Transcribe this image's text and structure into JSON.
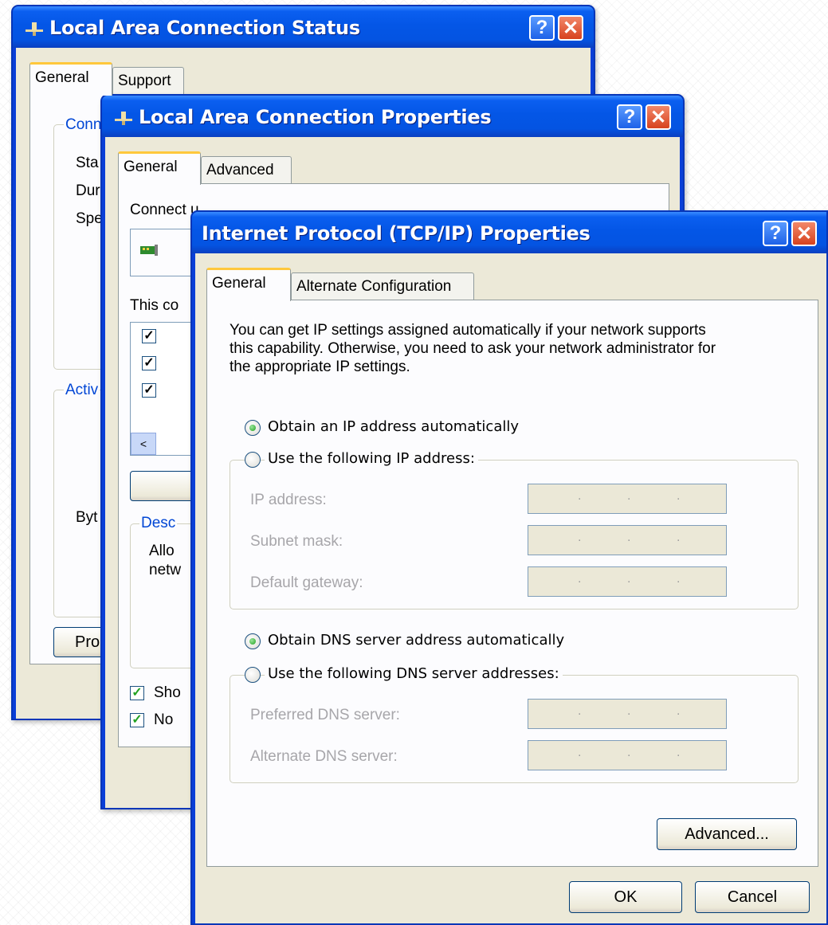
{
  "status_window": {
    "title": "Local Area Connection Status",
    "tabs": [
      "General",
      "Support"
    ],
    "connection_label": "Conn",
    "rows": [
      "Sta",
      "Dur",
      "Spe"
    ],
    "activity_label": "Activ",
    "bytes_label": "Byt",
    "properties_button": "Prop"
  },
  "properties_window": {
    "title": "Local Area Connection Properties",
    "tabs": [
      "General",
      "Advanced"
    ],
    "connect_using_label": "Connect u",
    "this_connection_label": "This co",
    "description_label": "Desc",
    "description_text": [
      "Allo",
      "netw"
    ],
    "show_icon_label": "Sho",
    "notify_label": "No"
  },
  "tcpip_window": {
    "title": "Internet Protocol (TCP/IP) Properties",
    "tabs": [
      "General",
      "Alternate Configuration"
    ],
    "intro_lines": [
      "You can get IP settings assigned automatically if your network supports",
      "this capability. Otherwise, you need to ask your network administrator for",
      "the appropriate IP settings."
    ],
    "obtain_ip_auto": "Obtain an IP address automatically",
    "use_following_ip": "Use the following IP address:",
    "ip_address_label": "IP address:",
    "subnet_mask_label": "Subnet mask:",
    "default_gateway_label": "Default gateway:",
    "obtain_dns_auto": "Obtain DNS server address automatically",
    "use_following_dns": "Use the following DNS server addresses:",
    "preferred_dns_label": "Preferred DNS server:",
    "alternate_dns_label": "Alternate DNS server:",
    "advanced_button": "Advanced...",
    "ok_button": "OK",
    "cancel_button": "Cancel"
  },
  "colors": {
    "title_blue": "#0454e2",
    "dialog_face": "#ece9d8",
    "group_label_blue": "#0046d5",
    "tab_highlight": "#ffc83c"
  },
  "icons": [
    "network-connection-icon",
    "help-icon",
    "close-icon",
    "network-adapter-icon",
    "scroll-left-icon"
  ]
}
